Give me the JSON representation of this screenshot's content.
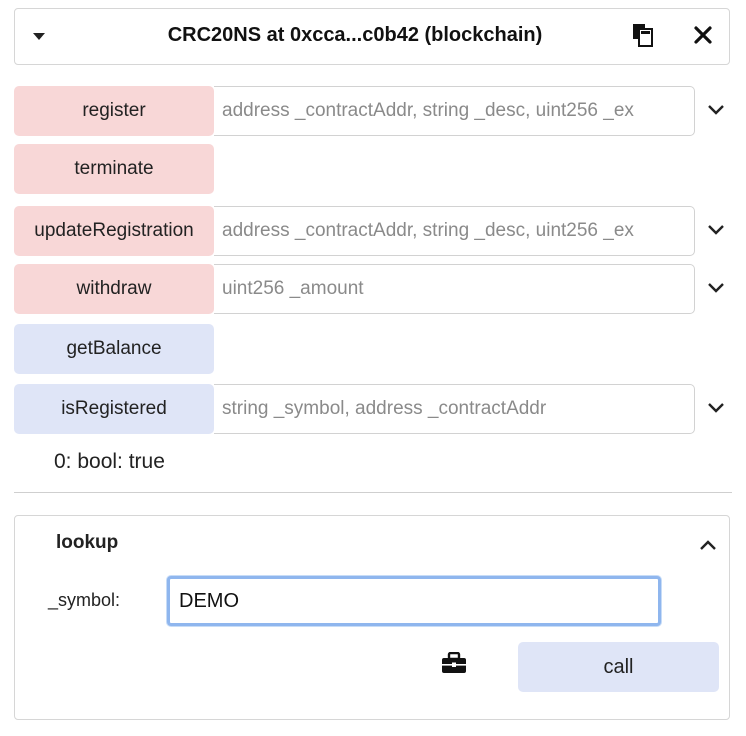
{
  "header": {
    "title": "CRC20NS at 0xcca...c0b42 (blockchain)"
  },
  "functions": [
    {
      "label": "register",
      "placeholder": "address _contractAddr, string _desc, uint256 _ex",
      "kind": "transact"
    },
    {
      "label": "terminate",
      "kind": "transact"
    },
    {
      "label": "updateRegistration",
      "placeholder": "address _contractAddr, string _desc, uint256 _ex",
      "kind": "transact"
    },
    {
      "label": "withdraw",
      "placeholder": "uint256 _amount",
      "kind": "transact"
    },
    {
      "label": "getBalance",
      "kind": "call"
    },
    {
      "label": "isRegistered",
      "placeholder": "string _symbol, address _contractAddr",
      "kind": "call"
    }
  ],
  "result": "0: bool: true",
  "lookup": {
    "title": "lookup",
    "param_label": "_symbol:",
    "param_value": "DEMO",
    "call_label": "call"
  },
  "colors": {
    "transact": "#f8d7d7",
    "call": "#dfe5f7",
    "focus_border": "#8fb6ee"
  },
  "icons": [
    "caret-down-icon",
    "copy-icon",
    "close-icon",
    "chevron-down-icon",
    "chevron-up-icon",
    "toolbox-icon"
  ]
}
